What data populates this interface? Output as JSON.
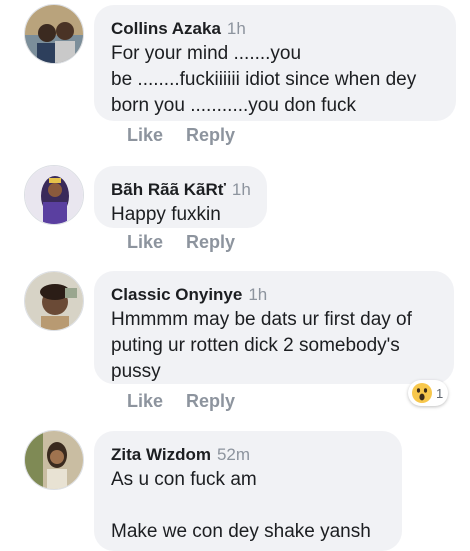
{
  "comments": [
    {
      "author": "Collins Azaka",
      "time": "1h",
      "lines": [
        "For your mind .......you",
        "be ........fuckiiiiii idiot since when dey",
        "born you ...........you don fuck"
      ],
      "like_label": "Like",
      "reply_label": "Reply"
    },
    {
      "author": "Bãh Rãã KãRť",
      "time": "1h",
      "lines": [
        "Happy fuxkin"
      ],
      "like_label": "Like",
      "reply_label": "Reply"
    },
    {
      "author": "Classic Onyinye",
      "time": "1h",
      "lines": [
        "Hmmmm may be dats ur first day of",
        "puting  ur rotten dick 2 somebody's",
        "pussy"
      ],
      "like_label": "Like",
      "reply_label": "Reply",
      "reaction": {
        "icon": "wow-emoji-icon",
        "count": "1"
      }
    },
    {
      "author": "Zita Wizdom",
      "time": "52m",
      "lines": [
        "As u con fuck am",
        "",
        "Make we con dey shake yansh"
      ]
    }
  ],
  "colors": {
    "bubble": "#f1f2f5",
    "muted": "#8d949e",
    "text": "#1c1e21"
  }
}
